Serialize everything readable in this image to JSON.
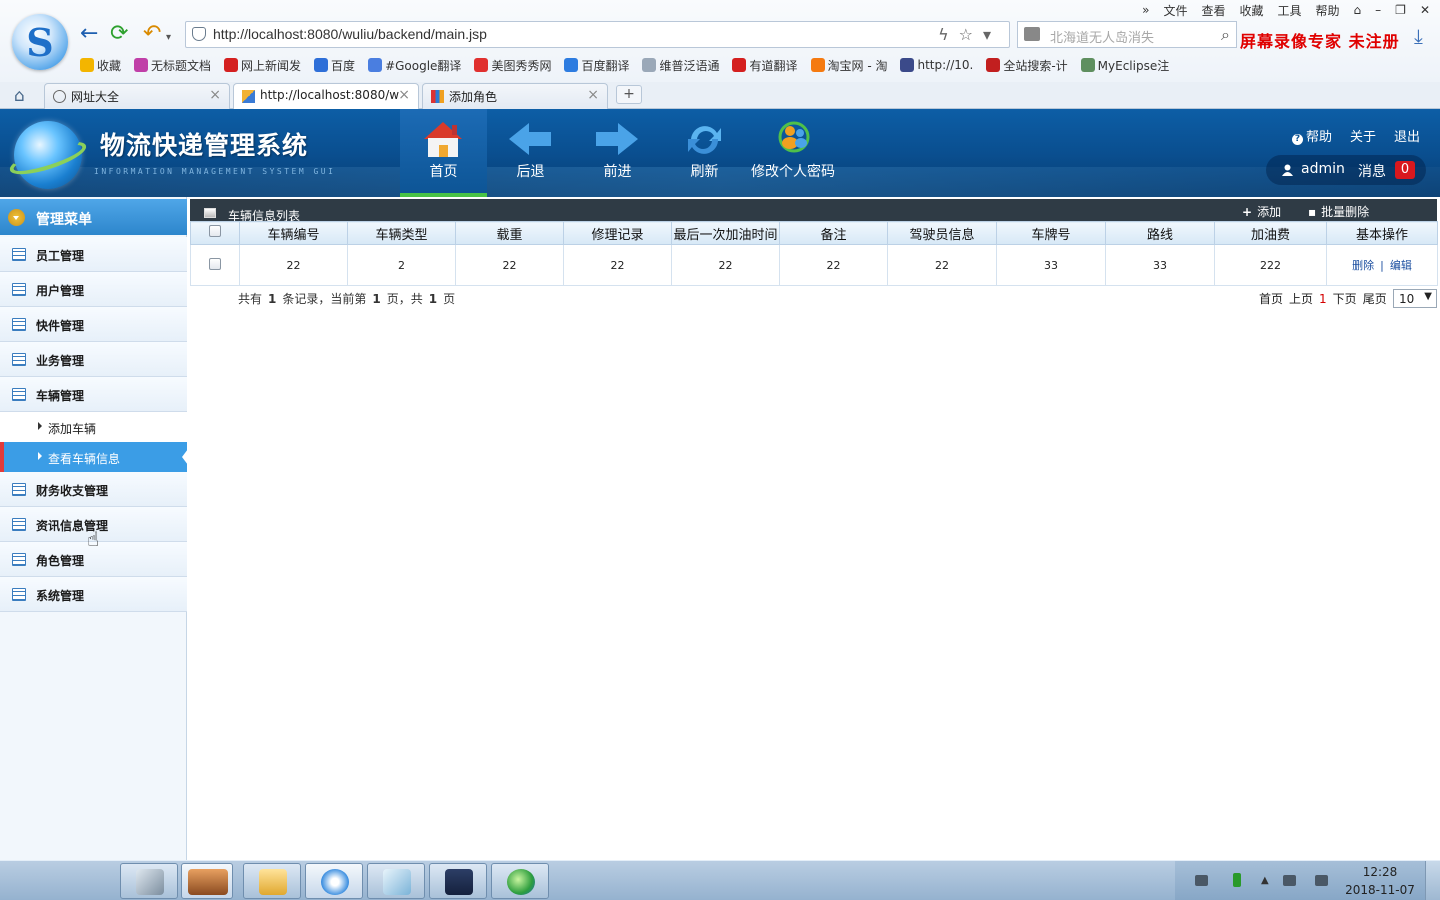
{
  "browser": {
    "url": "http://localhost:8080/wuliu/backend/main.jsp",
    "search_placeholder": "北海道无人岛消失",
    "menu": [
      "文件",
      "查看",
      "收藏",
      "工具",
      "帮助"
    ],
    "watermark": "屏幕录像专家 未注册",
    "bookmarks": [
      {
        "label": "收藏",
        "icon": "star-icon",
        "color": "#f3b500"
      },
      {
        "label": "无标题文档",
        "icon": "doc-icon",
        "color": "#c03fa8"
      },
      {
        "label": "网上新闻发",
        "icon": "news-icon",
        "color": "#d42020"
      },
      {
        "label": "百度",
        "icon": "paw-icon",
        "color": "#2e6fd8"
      },
      {
        "label": "#Google翻译",
        "icon": "translate-icon",
        "color": "#4a7ee0"
      },
      {
        "label": "美图秀秀网",
        "icon": "meitu-icon",
        "color": "#e0302f"
      },
      {
        "label": "百度翻译",
        "icon": "fanyi-icon",
        "color": "#2d7ce0"
      },
      {
        "label": "维普泛语通",
        "icon": "page-icon",
        "color": "#9aa8b8"
      },
      {
        "label": "有道翻译",
        "icon": "youdao-icon",
        "color": "#d41f1f"
      },
      {
        "label": "淘宝网 - 淘",
        "icon": "taobao-icon",
        "color": "#f57a10"
      },
      {
        "label": "http://10.",
        "icon": "oa-icon",
        "color": "#3b4a8a"
      },
      {
        "label": "全站搜索-计",
        "icon": "search-site-icon",
        "color": "#c21f1f"
      },
      {
        "label": "MyEclipse注",
        "icon": "gear-icon",
        "color": "#5f8f5f"
      }
    ],
    "tabs": [
      {
        "label": "网址大全",
        "icon": "globe-icon"
      },
      {
        "label": "http://localhost:8080/w",
        "icon": "page-icon"
      },
      {
        "label": "添加角色",
        "icon": "grid-icon"
      }
    ]
  },
  "header": {
    "title": "物流快递管理系统",
    "subtitle": "INFORMATION MANAGEMENT SYSTEM GUI",
    "nav": [
      {
        "label": "首页",
        "icon": "home-icon"
      },
      {
        "label": "后退",
        "icon": "arrow-left-icon"
      },
      {
        "label": "前进",
        "icon": "arrow-right-icon"
      },
      {
        "label": "刷新",
        "icon": "refresh-icon"
      },
      {
        "label": "修改个人密码",
        "icon": "users-icon"
      }
    ],
    "links": {
      "help": "帮助",
      "about": "关于",
      "logout": "退出"
    },
    "user": {
      "name": "admin",
      "msg_label": "消息",
      "msg_count": "0"
    }
  },
  "sidebar": {
    "title": "管理菜单",
    "items": [
      {
        "label": "员工管理"
      },
      {
        "label": "用户管理"
      },
      {
        "label": "快件管理"
      },
      {
        "label": "业务管理"
      },
      {
        "label": "车辆管理"
      },
      {
        "label": "财务收支管理"
      },
      {
        "label": "资讯信息管理"
      },
      {
        "label": "角色管理"
      },
      {
        "label": "系统管理"
      }
    ],
    "subitems": [
      {
        "label": "添加车辆"
      },
      {
        "label": "查看车辆信息"
      }
    ]
  },
  "panel": {
    "title": "车辆信息列表",
    "add_label": "添加",
    "batch_delete_label": "批量删除"
  },
  "table": {
    "columns": [
      "车辆编号",
      "车辆类型",
      "载重",
      "修理记录",
      "最后一次加油时间",
      "备注",
      "驾驶员信息",
      "车牌号",
      "路线",
      "加油费",
      "基本操作"
    ],
    "rows": [
      {
        "cells": [
          "22",
          "2",
          "22",
          "22",
          "22",
          "22",
          "22",
          "33",
          "33",
          "222"
        ],
        "delete": "删除",
        "sep": "|",
        "edit": "编辑"
      }
    ]
  },
  "pager": {
    "prefix": "共有",
    "total": "1",
    "mid1": "条记录，当前第",
    "current": "1",
    "mid2": "页，共",
    "pages": "1",
    "suffix": "页",
    "first": "首页",
    "prev": "上页",
    "page_num": "1",
    "next": "下页",
    "last": "尾页",
    "page_size": "10"
  },
  "taskbar": {
    "time": "12:28",
    "date": "2018-11-07"
  },
  "colors": {
    "header_blue": "#0a4f90",
    "active_green": "#49c346",
    "sidebar_active": "#3b9de6",
    "badge_red": "#d9181e",
    "link_blue": "#1c4fa0"
  }
}
